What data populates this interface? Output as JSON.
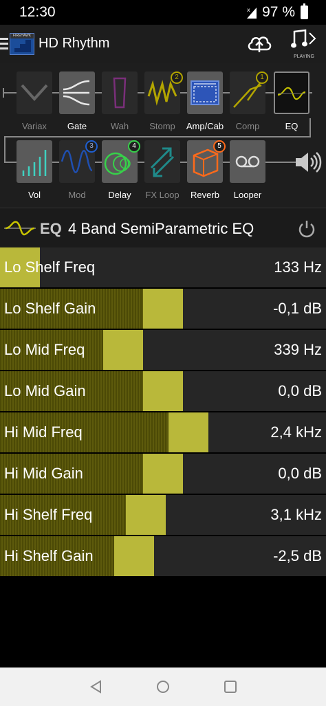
{
  "status": {
    "time": "12:30",
    "battery": "97 %"
  },
  "app": {
    "title": "HD Rhythm",
    "logo_text": "FIREHAWK",
    "playing_label": "PLAYING"
  },
  "chain": {
    "row1": [
      {
        "label": "Variax",
        "active": false
      },
      {
        "label": "Gate",
        "active": true
      },
      {
        "label": "Wah",
        "active": false
      },
      {
        "label": "Stomp",
        "active": false,
        "badge": "2"
      },
      {
        "label": "Amp/Cab",
        "active": true
      },
      {
        "label": "Comp",
        "active": false,
        "badge": "1"
      },
      {
        "label": "EQ",
        "active": true,
        "selected": true
      }
    ],
    "row2": [
      {
        "label": "Vol",
        "active": true
      },
      {
        "label": "Mod",
        "active": false,
        "badge": "3"
      },
      {
        "label": "Delay",
        "active": true,
        "badge": "4"
      },
      {
        "label": "FX Loop",
        "active": false
      },
      {
        "label": "Reverb",
        "active": true,
        "badge": "5"
      },
      {
        "label": "Looper",
        "active": true
      }
    ],
    "colors": {
      "mod": "#1f5fd0",
      "delay": "#37d14a",
      "reverb": "#ff6a1a",
      "vol": "#3fd1c0",
      "stomp": "#c8c400"
    }
  },
  "effect": {
    "tag": "EQ",
    "name": "4 Band SemiParametric EQ"
  },
  "params": [
    {
      "name": "Lo Shelf Freq",
      "value": "133 Hz",
      "level": 0.0
    },
    {
      "name": "Lo Shelf Gain",
      "value": "-0,1 dB",
      "level": 0.5
    },
    {
      "name": "Lo Mid Freq",
      "value": "339 Hz",
      "level": 0.36
    },
    {
      "name": "Lo Mid Gain",
      "value": "0,0 dB",
      "level": 0.5
    },
    {
      "name": "Hi Mid Freq",
      "value": "2,4 kHz",
      "level": 0.59
    },
    {
      "name": "Hi Mid Gain",
      "value": "0,0 dB",
      "level": 0.5
    },
    {
      "name": "Hi Shelf Freq",
      "value": "3,1 kHz",
      "level": 0.44
    },
    {
      "name": "Hi Shelf Gain",
      "value": "-2,5 dB",
      "level": 0.4
    }
  ]
}
